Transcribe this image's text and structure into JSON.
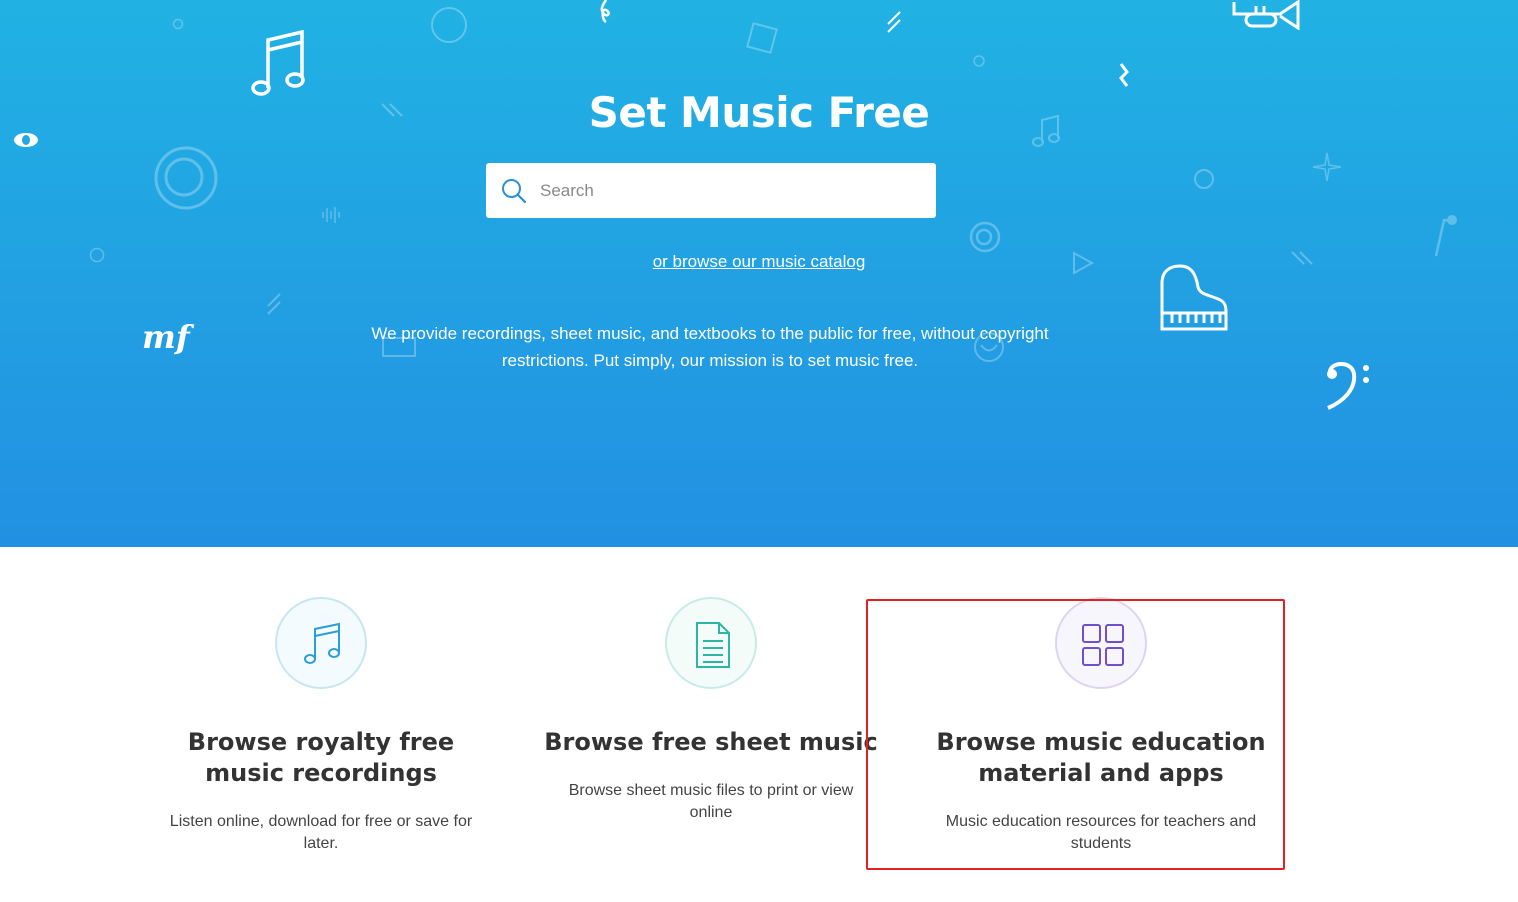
{
  "hero": {
    "title": "Set Music Free",
    "search_placeholder": "Search",
    "browse_link": "or browse our music catalog",
    "mission": "We provide recordings, sheet music, and textbooks to the public for free, without copyright restrictions. Put simply, our mission is to set music free.",
    "decorations": [
      "beamed-notes-icon",
      "eighth-note-icon",
      "treble-clef-icon",
      "mf-dynamic-icon",
      "piano-icon",
      "bass-clef-icon",
      "trumpet-icon",
      "star-icon",
      "fermata-icon",
      "rest-icon",
      "play-icon"
    ]
  },
  "cards": [
    {
      "title": "Browse royalty free music recordings",
      "description": "Listen online, download for free or save for later.",
      "icon": "music-notes-icon",
      "accent": "#2a9fd6"
    },
    {
      "title": "Browse free sheet music",
      "description": "Browse sheet music files to print or view online",
      "icon": "document-icon",
      "accent": "#2bb6a3"
    },
    {
      "title": "Browse music education material and apps",
      "description": "Music education resources for teachers and students",
      "icon": "grid-apps-icon",
      "accent": "#6f4fcf"
    }
  ],
  "colors": {
    "hero_top": "#21b2e3",
    "hero_bottom": "#2290e2",
    "highlight": "#e62020"
  }
}
